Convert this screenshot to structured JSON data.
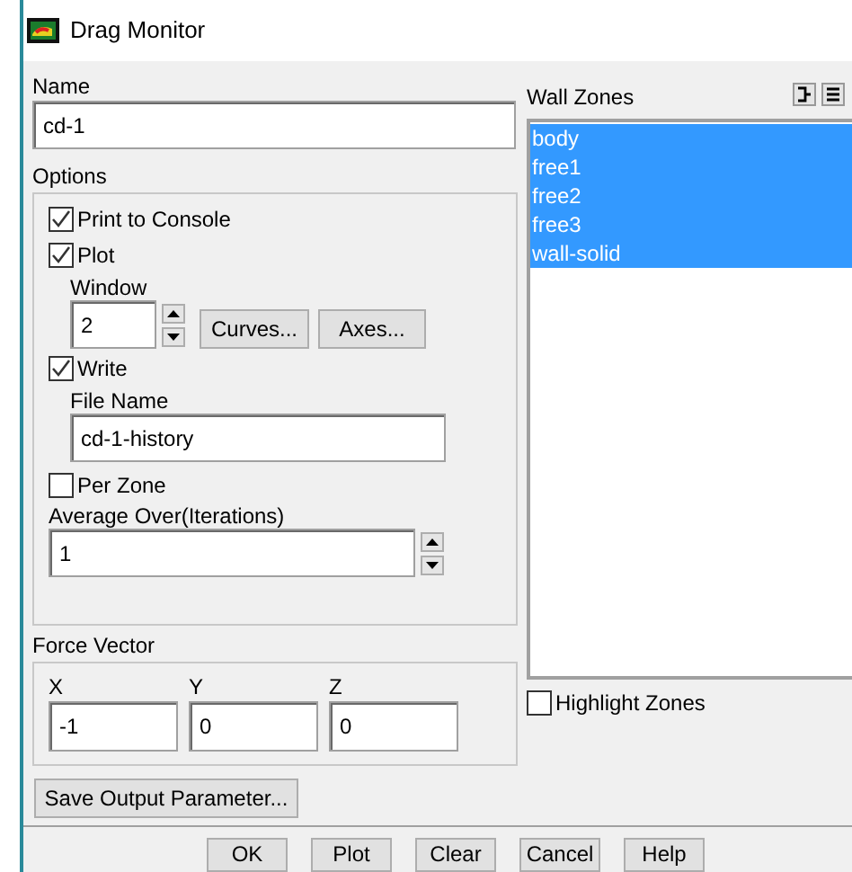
{
  "window": {
    "title": "Drag Monitor"
  },
  "name": {
    "label": "Name",
    "value": "cd-1"
  },
  "options": {
    "label": "Options",
    "print_to_console": {
      "label": "Print to Console",
      "checked": true
    },
    "plot": {
      "label": "Plot",
      "checked": true
    },
    "window_field": {
      "label": "Window",
      "value": "2"
    },
    "plot_buttons": [
      "Curves...",
      "Axes..."
    ],
    "write": {
      "label": "Write",
      "checked": true
    },
    "file_name": {
      "label": "File Name",
      "value": "cd-1-history"
    },
    "per_zone": {
      "label": "Per Zone",
      "checked": false
    },
    "average_over": {
      "label": "Average Over(Iterations)",
      "value": "1"
    }
  },
  "force_vector": {
    "label": "Force Vector",
    "components": [
      {
        "label": "X",
        "value": "-1"
      },
      {
        "label": "Y",
        "value": "0"
      },
      {
        "label": "Z",
        "value": "0"
      }
    ]
  },
  "save_button": "Save Output Parameter...",
  "wall_zones": {
    "label": "Wall Zones",
    "items": [
      {
        "label": "body",
        "selected": true
      },
      {
        "label": "free1",
        "selected": true
      },
      {
        "label": "free2",
        "selected": true
      },
      {
        "label": "free3",
        "selected": true
      },
      {
        "label": "wall-solid",
        "selected": true
      }
    ],
    "highlight_zones": {
      "label": "Highlight Zones",
      "checked": false
    }
  },
  "buttons": [
    "OK",
    "Plot",
    "Clear",
    "Cancel",
    "Help"
  ]
}
